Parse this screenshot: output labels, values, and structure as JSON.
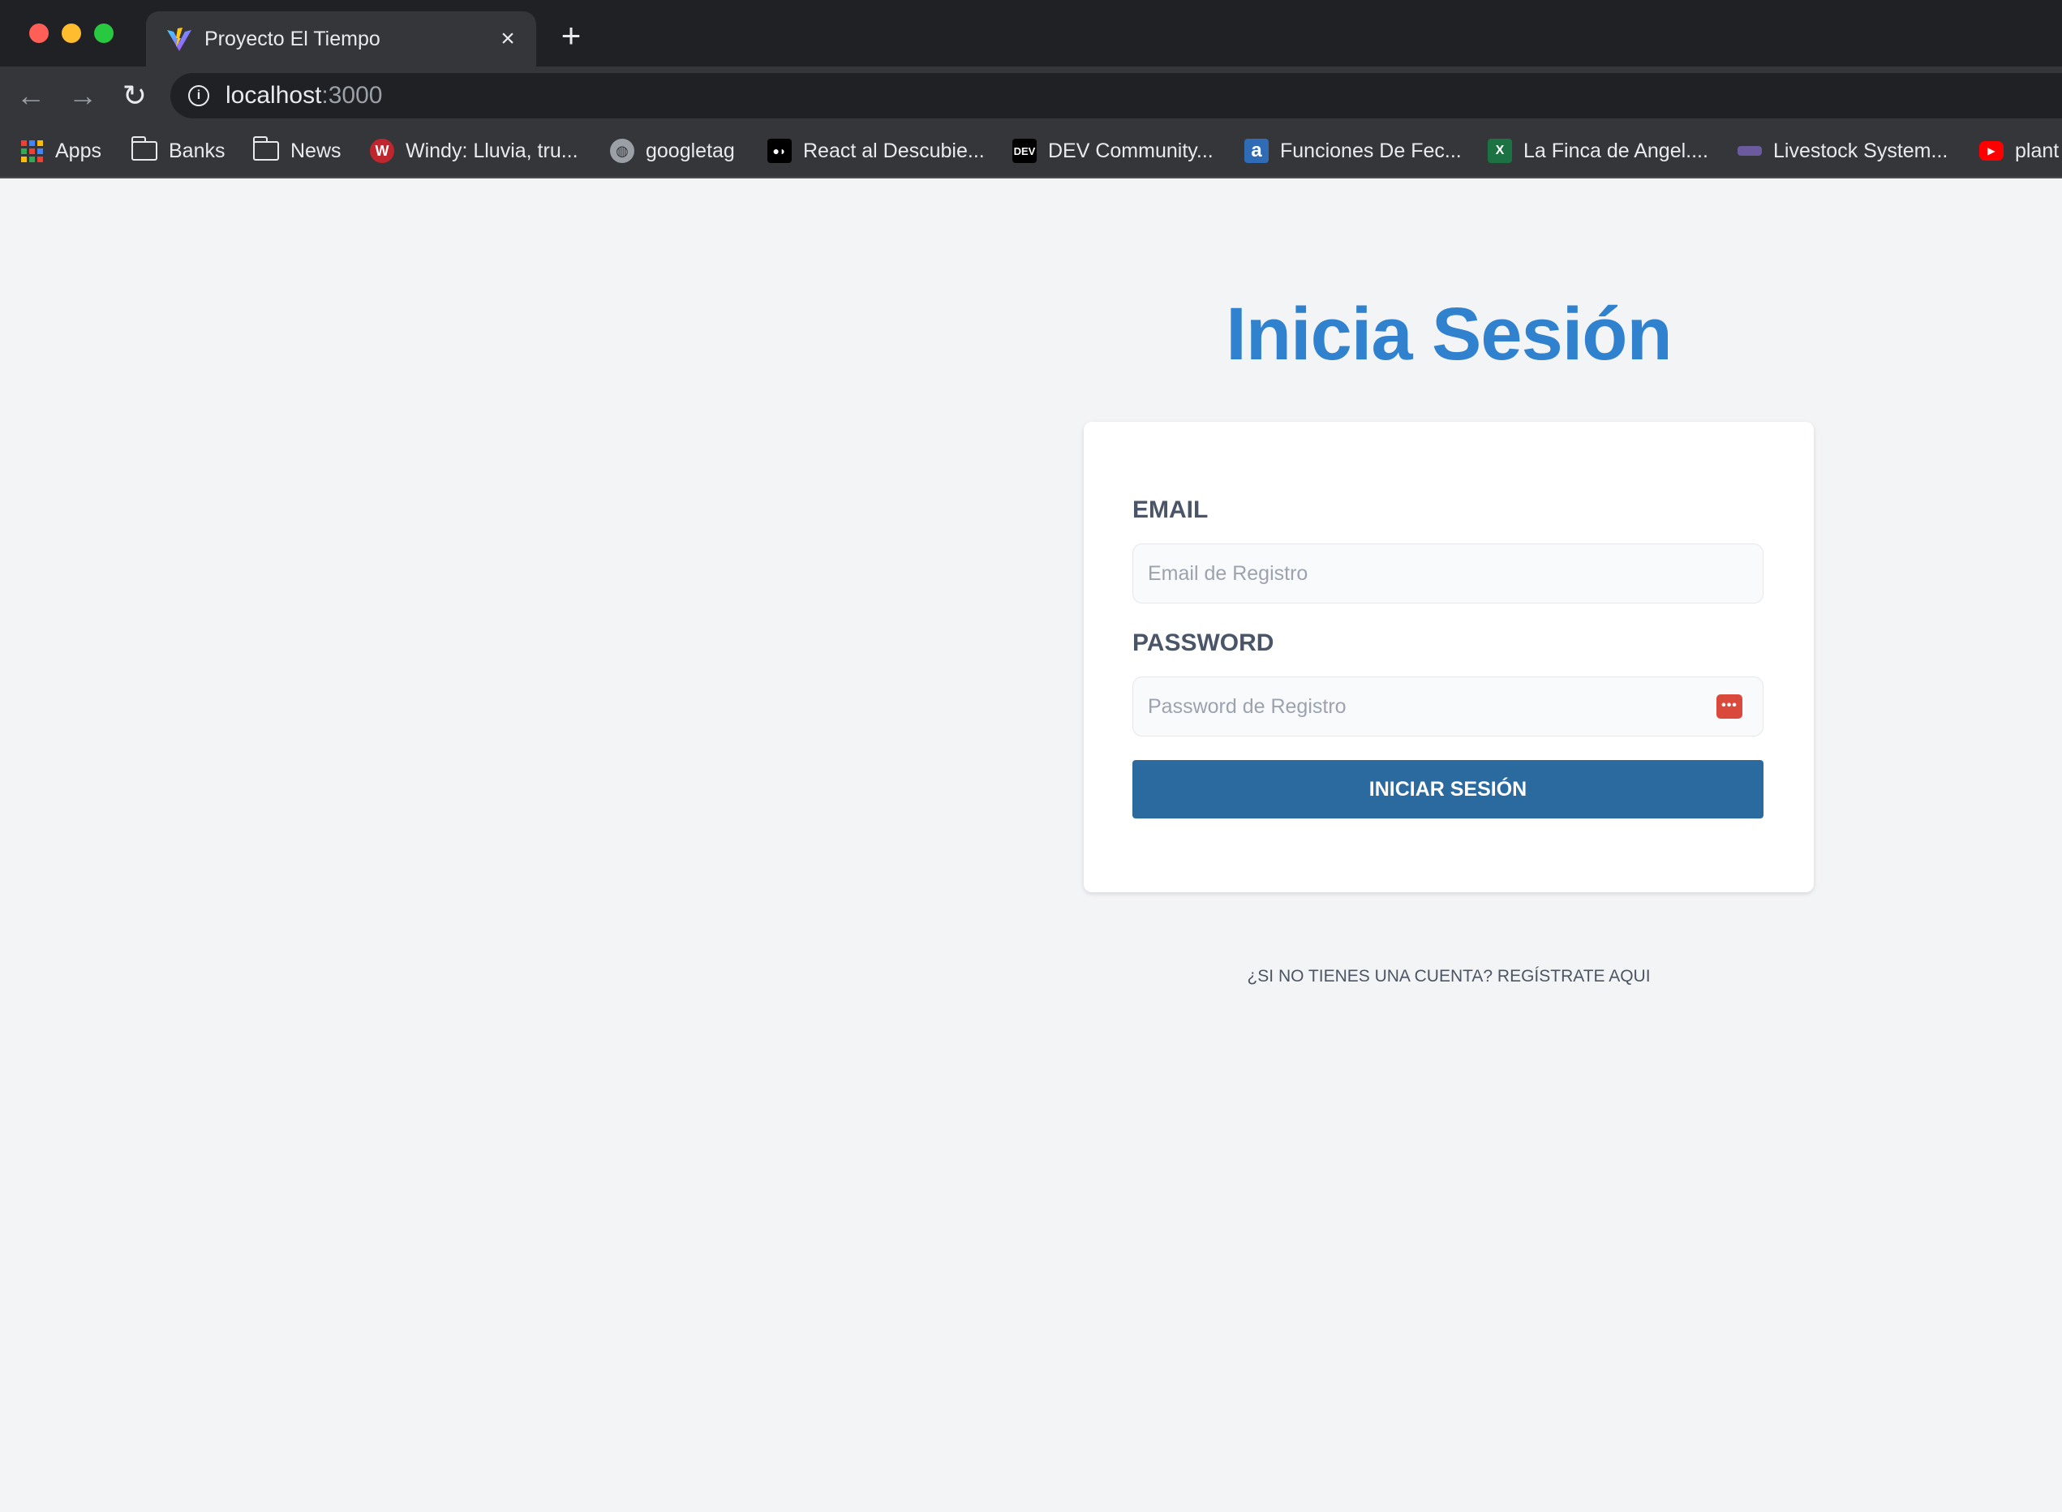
{
  "browser": {
    "tab": {
      "title": "Proyecto El Tiempo",
      "favicon": "vite-logo-icon"
    },
    "new_tab_label": "+",
    "close_tab_label": "×",
    "address": {
      "host": "localhost",
      "port": ":3000"
    },
    "nav": {
      "back": "←",
      "forward": "→",
      "reload": "↻"
    },
    "bookmarks": [
      {
        "label": "Apps",
        "icon": "apps-grid-icon"
      },
      {
        "label": "Banks",
        "icon": "folder-icon"
      },
      {
        "label": "News",
        "icon": "folder-icon"
      },
      {
        "label": "Windy: Lluvia, tru...",
        "icon": "windy-icon"
      },
      {
        "label": "googletag",
        "icon": "globe-icon"
      },
      {
        "label": "React al Descubie...",
        "icon": "medium-icon"
      },
      {
        "label": "DEV Community...",
        "icon": "dev-icon"
      },
      {
        "label": "Funciones De Fec...",
        "icon": "a-site-icon"
      },
      {
        "label": "La Finca de Angel....",
        "icon": "excel-icon"
      },
      {
        "label": "Livestock System...",
        "icon": "livestock-icon"
      },
      {
        "label": "plant",
        "icon": "youtube-icon"
      }
    ]
  },
  "page": {
    "title": "Inicia Sesión",
    "form": {
      "email_label": "EMAIL",
      "email_placeholder": "Email de Registro",
      "email_value": "",
      "password_label": "PASSWORD",
      "password_placeholder": "Password de Registro",
      "password_value": "",
      "password_manager_glyph": "•••",
      "submit_label": "Iniciar Sesión"
    },
    "register_link": "¿Si no tienes una cuenta? Regístrate aqui"
  },
  "colors": {
    "title": "#3182ce",
    "button": "#2b6a9e",
    "background": "#f3f4f6",
    "label": "#4a5568"
  }
}
